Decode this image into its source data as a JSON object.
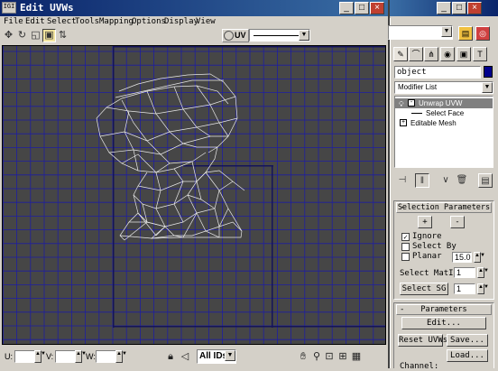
{
  "window": {
    "title": "Edit UVWs",
    "icon_text": "IGI"
  },
  "menu": [
    "File",
    "Edit",
    "Select",
    "Tools",
    "Mapping",
    "Options",
    "Display",
    "View"
  ],
  "toolbar": {
    "uv_label": "UV"
  },
  "statusbar": {
    "u_label": "U:",
    "v_label": "V:",
    "w_label": "W:",
    "ids_value": "All IDs",
    "icons": [
      "lock-icon",
      "paint-select-icon",
      "pan-icon",
      "zoom-icon",
      "zoom-region-icon",
      "zoom-extents-icon",
      "grid-snap-icon"
    ]
  },
  "panel": {
    "object_name": "object",
    "object_color": "#00008b",
    "modifier_list_label": "Modifier List",
    "stack": [
      {
        "label": "Unwrap UVW",
        "expander": "-",
        "selected": true
      },
      {
        "label": "Select Face",
        "expander": "",
        "selected": false
      },
      {
        "label": "Editable Mesh",
        "expander": "+",
        "selected": false
      }
    ],
    "selection": {
      "title": "Selection Parameters",
      "plus": "+",
      "minus": "-",
      "ignore_label": "Ignore",
      "ignore_checked": true,
      "select_by_label": "Select By",
      "select_by_checked": false,
      "planar_label": "Planar",
      "planar_checked": false,
      "planar_value": "15.0",
      "matid_label": "Select MatID",
      "matid_value": "1",
      "sg_label": "Select SG",
      "sg_value": "1"
    },
    "parameters": {
      "title": "Parameters",
      "edit_label": "Edit...",
      "reset_label": "Reset UVWs",
      "save_label": "Save...",
      "load_label": "Load...",
      "channel_label": "Channel:"
    }
  },
  "colors": {
    "viewport_bg": "#464646",
    "grid": "#1e1ea0",
    "mesh": "#e8e8e8",
    "title_bar": "#0a246a"
  }
}
